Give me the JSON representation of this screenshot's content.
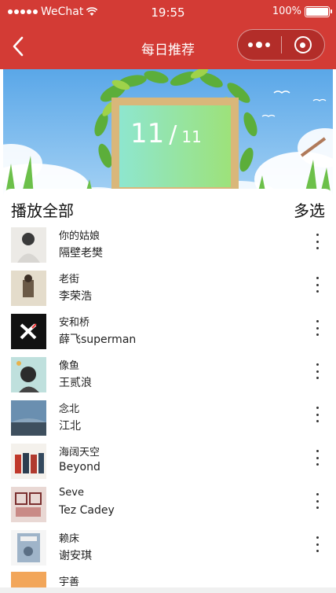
{
  "statusbar": {
    "carrier": "WeChat",
    "time": "19:55",
    "battery": "100%",
    "battery_level": 1.0
  },
  "navbar": {
    "title": "每日推荐",
    "back_icon": "chevron-left-icon",
    "more_icon": "more-dots-icon",
    "close_icon": "target-icon"
  },
  "banner": {
    "day": "11",
    "separator": "/",
    "month": "11"
  },
  "list_header": {
    "play_all": "播放全部",
    "multi_select": "多选"
  },
  "songs": [
    {
      "title": "你的姑娘",
      "artist": "隔壁老樊"
    },
    {
      "title": "老街",
      "artist": "李荣浩"
    },
    {
      "title": "安和桥",
      "artist": "薛飞superman"
    },
    {
      "title": "像鱼",
      "artist": "王贰浪"
    },
    {
      "title": "念北",
      "artist": "江北"
    },
    {
      "title": "海阔天空",
      "artist": "Beyond"
    },
    {
      "title": "Seve",
      "artist": "Tez Cadey"
    },
    {
      "title": "赖床",
      "artist": "谢安琪"
    }
  ],
  "partial_song": {
    "title": "宇善"
  },
  "colors": {
    "brand_red": "#d33b35",
    "background": "#ffffff"
  }
}
